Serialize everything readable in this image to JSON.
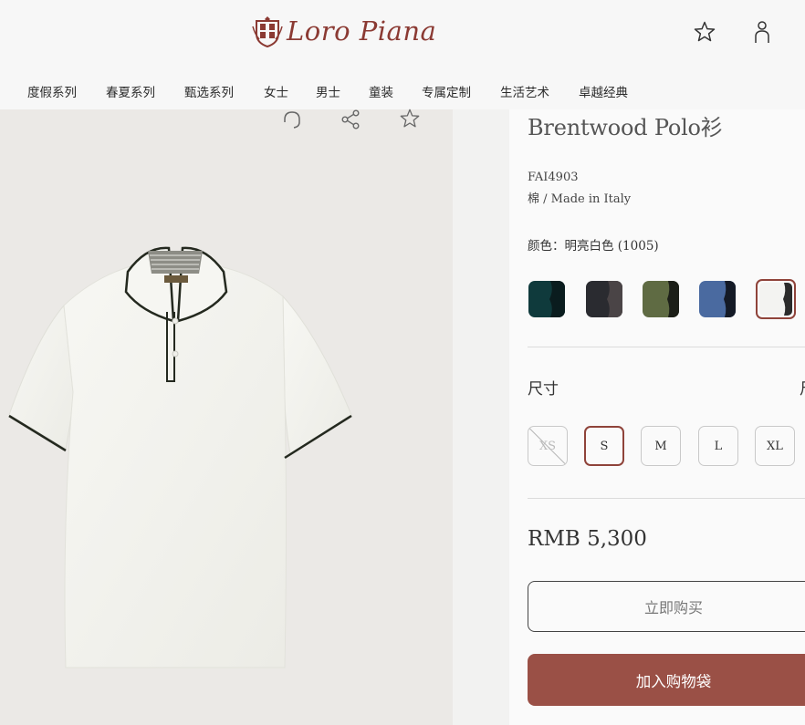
{
  "header": {
    "brand_text": "Loro Piana",
    "icons": [
      "wishlist-star-icon",
      "account-person-icon"
    ]
  },
  "nav": {
    "items": [
      {
        "label": "度假系列"
      },
      {
        "label": "春夏系列"
      },
      {
        "label": "甄选系列"
      },
      {
        "label": "女士"
      },
      {
        "label": "男士"
      },
      {
        "label": "童装"
      },
      {
        "label": "专属定制"
      },
      {
        "label": "生活艺术"
      },
      {
        "label": "卓越经典"
      }
    ]
  },
  "image_tools": [
    "headset-support-icon",
    "share-icon",
    "favorite-star-icon"
  ],
  "product": {
    "title": "Brentwood Polo衫",
    "code": "FAI4903",
    "material": "棉 / Made in Italy",
    "color_label": "颜色：",
    "color_value": "明亮白色 (1005)",
    "swatches": [
      {
        "name": "dark teal",
        "colors": [
          "#0f3a3c",
          "#0a1c1e"
        ]
      },
      {
        "name": "charcoal",
        "colors": [
          "#2a2b30",
          "#4a4446"
        ]
      },
      {
        "name": "olive",
        "colors": [
          "#5f6b43",
          "#1c1f18"
        ]
      },
      {
        "name": "blue",
        "colors": [
          "#4a6aa0",
          "#141a26"
        ]
      },
      {
        "name": "bright white",
        "colors": [
          "#f3f3f1",
          "#2b2b2b"
        ],
        "selected": true
      }
    ],
    "size_label": "尺寸",
    "size_guide_label": "尺",
    "sizes": [
      {
        "label": "XS",
        "available": false
      },
      {
        "label": "S",
        "available": true,
        "selected": true
      },
      {
        "label": "M",
        "available": true
      },
      {
        "label": "L",
        "available": true
      },
      {
        "label": "XL",
        "available": true
      }
    ],
    "price": "RMB 5,300",
    "buy_now_label": "立即购买",
    "add_to_bag_label": "加入购物袋"
  },
  "colors": {
    "brand": "#8b3a33",
    "accent_button": "#9a5046",
    "selected_border": "#8f433a"
  }
}
